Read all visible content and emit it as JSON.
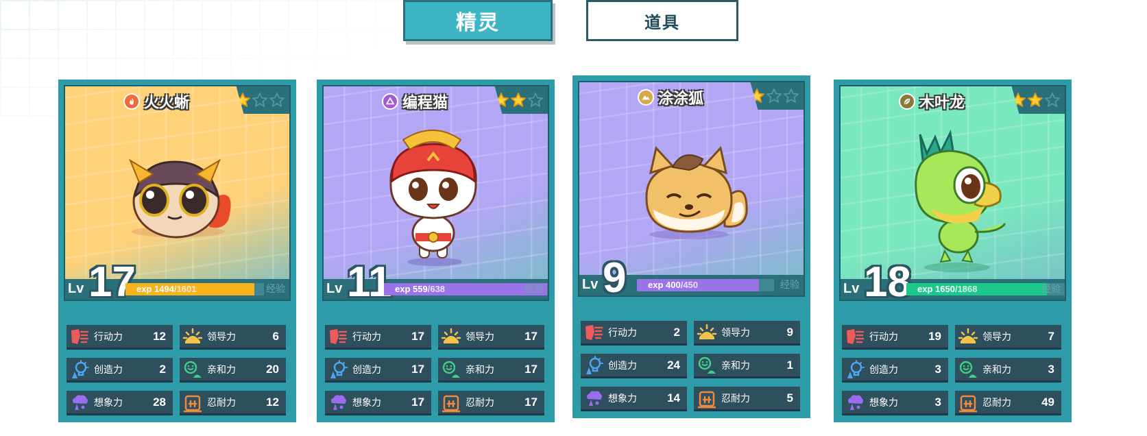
{
  "tabs": {
    "spirits": "精灵",
    "items": "道具"
  },
  "exp_label": "exp",
  "exp_side_label": "经验",
  "lv_label": "Lv",
  "colors": {
    "teal_frame": "#2d9ba8",
    "dark_panel": "#2e4f5d",
    "tab_active": "#3eb5c4"
  },
  "cards": [
    {
      "name": "火火蜥",
      "element": "fire",
      "stars": 1,
      "max_stars": 3,
      "level": "17",
      "exp_current": "1494",
      "exp_max": "/1601",
      "exp_fraction": 0.933,
      "bg_color": "#ffd27a",
      "exp_color": "#f7b21c",
      "stats": [
        {
          "label": "行动力",
          "value": "12",
          "icon": "action-icon"
        },
        {
          "label": "领导力",
          "value": "6",
          "icon": "leadership-icon"
        },
        {
          "label": "创造力",
          "value": "2",
          "icon": "creativity-icon"
        },
        {
          "label": "亲和力",
          "value": "20",
          "icon": "affinity-icon"
        },
        {
          "label": "想象力",
          "value": "28",
          "icon": "imagination-icon"
        },
        {
          "label": "忍耐力",
          "value": "12",
          "icon": "endurance-icon"
        }
      ]
    },
    {
      "name": "编程猫",
      "element": "psychic",
      "stars": 2,
      "max_stars": 3,
      "level": "11",
      "exp_current": "559",
      "exp_max": "/638",
      "exp_fraction": 0.876,
      "bg_color": "#b3a6f5",
      "exp_color": "#9b73e8",
      "stats": [
        {
          "label": "行动力",
          "value": "17",
          "icon": "action-icon"
        },
        {
          "label": "领导力",
          "value": "17",
          "icon": "leadership-icon"
        },
        {
          "label": "创造力",
          "value": "17",
          "icon": "creativity-icon"
        },
        {
          "label": "亲和力",
          "value": "17",
          "icon": "affinity-icon"
        },
        {
          "label": "想象力",
          "value": "17",
          "icon": "imagination-icon"
        },
        {
          "label": "忍耐力",
          "value": "17",
          "icon": "endurance-icon"
        }
      ]
    },
    {
      "name": "涂涂狐",
      "element": "earth",
      "stars": 1,
      "max_stars": 3,
      "level": "9",
      "exp_current": "400",
      "exp_max": "/450",
      "exp_fraction": 0.889,
      "bg_color": "#b3a6f5",
      "exp_color": "#9b73e8",
      "stats": [
        {
          "label": "行动力",
          "value": "2",
          "icon": "action-icon"
        },
        {
          "label": "领导力",
          "value": "9",
          "icon": "leadership-icon"
        },
        {
          "label": "创造力",
          "value": "24",
          "icon": "creativity-icon"
        },
        {
          "label": "亲和力",
          "value": "1",
          "icon": "affinity-icon"
        },
        {
          "label": "想象力",
          "value": "14",
          "icon": "imagination-icon"
        },
        {
          "label": "忍耐力",
          "value": "5",
          "icon": "endurance-icon"
        }
      ]
    },
    {
      "name": "木叶龙",
      "element": "grass",
      "stars": 2,
      "max_stars": 3,
      "level": "18",
      "exp_current": "1650",
      "exp_max": "/1868",
      "exp_fraction": 0.883,
      "bg_color": "#7ae8bf",
      "exp_color": "#1dc98a",
      "stats": [
        {
          "label": "行动力",
          "value": "19",
          "icon": "action-icon"
        },
        {
          "label": "领导力",
          "value": "7",
          "icon": "leadership-icon"
        },
        {
          "label": "创造力",
          "value": "3",
          "icon": "creativity-icon"
        },
        {
          "label": "亲和力",
          "value": "3",
          "icon": "affinity-icon"
        },
        {
          "label": "想象力",
          "value": "3",
          "icon": "imagination-icon"
        },
        {
          "label": "忍耐力",
          "value": "49",
          "icon": "endurance-icon"
        }
      ]
    }
  ]
}
